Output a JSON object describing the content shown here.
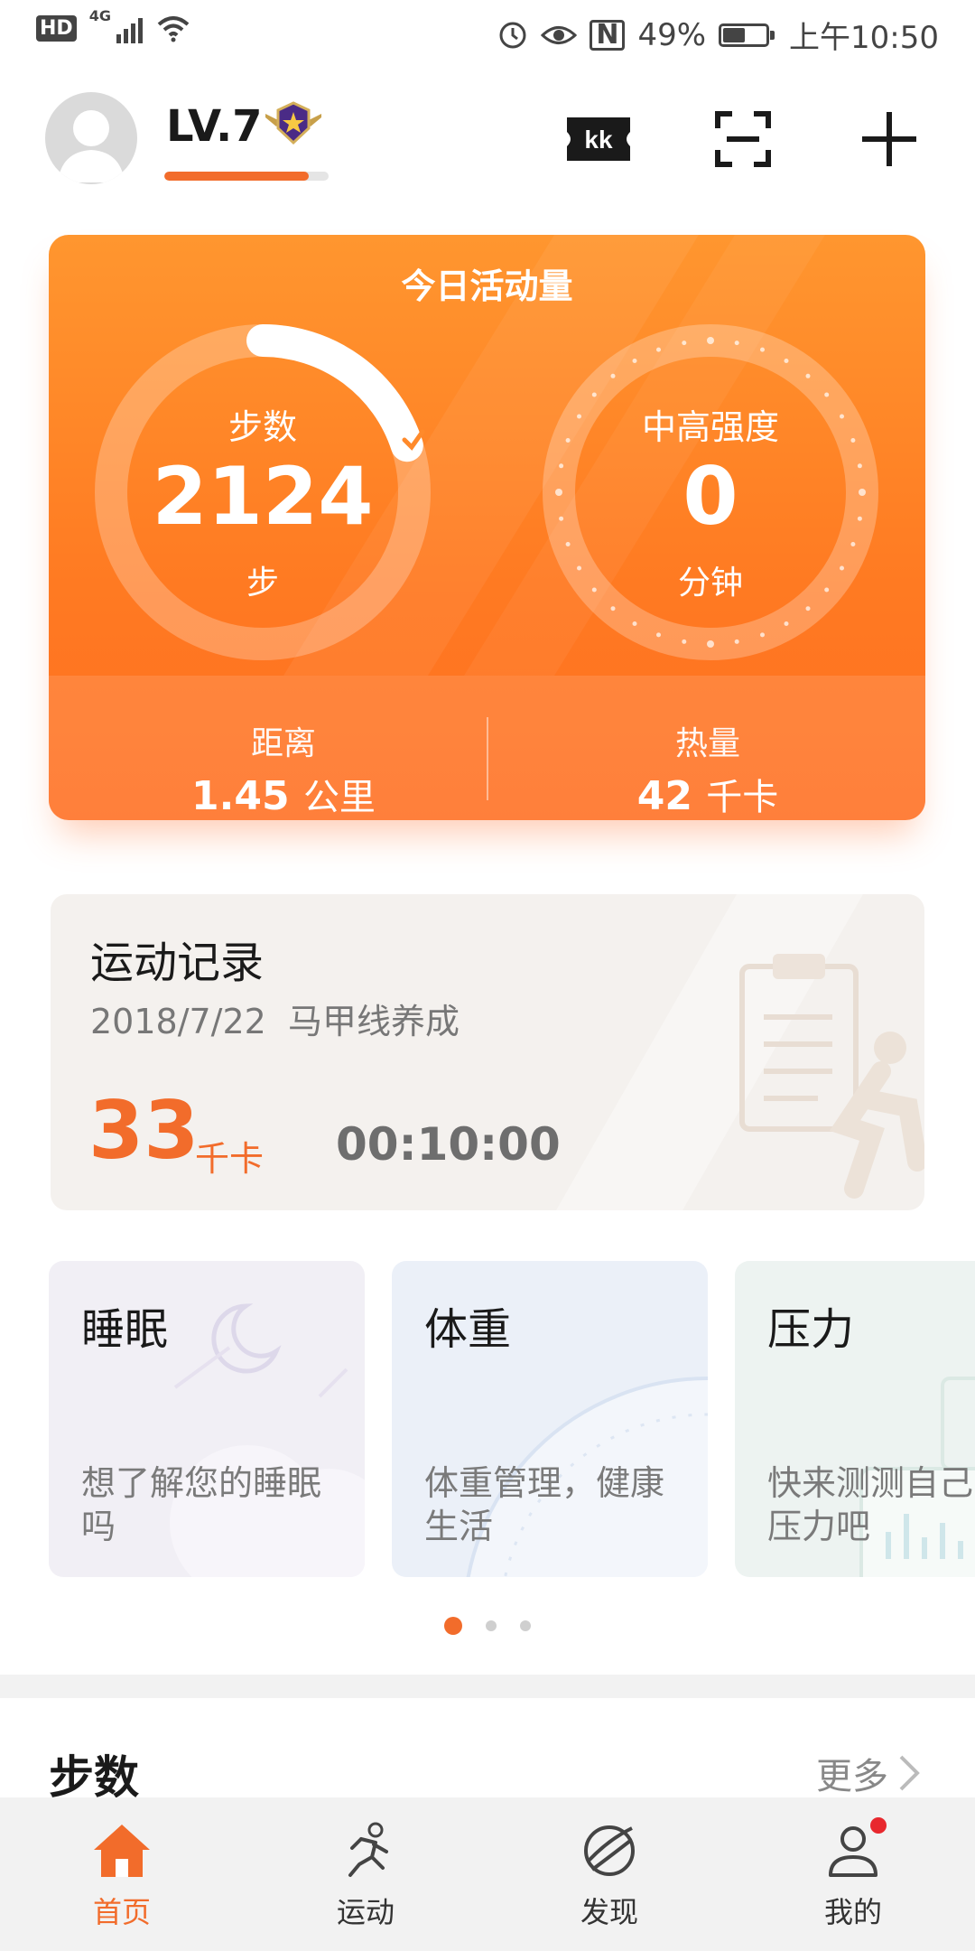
{
  "status_bar": {
    "hd": "HD",
    "signal": "4G",
    "nfc": "N",
    "battery": "49%",
    "time": "上午10:50"
  },
  "header": {
    "level": "LV.7",
    "level_progress": 0.88,
    "ticket_icon_text": "kk"
  },
  "activity": {
    "title": "今日活动量",
    "steps_label": "步数",
    "steps_value": "2124",
    "steps_unit": "步",
    "steps_goal_progress": 0.2,
    "intensity_label": "中高强度",
    "intensity_value": "0",
    "intensity_unit": "分钟",
    "distance_label": "距离",
    "distance_value": "1.45",
    "distance_unit": "公里",
    "calories_label": "热量",
    "calories_value": "42",
    "calories_unit": "千卡"
  },
  "record": {
    "title": "运动记录",
    "date": "2018/7/22",
    "activity": "马甲线养成",
    "calories": "33",
    "calories_unit": "千卡",
    "duration": "00:10:00"
  },
  "cards": [
    {
      "title": "睡眠",
      "subtitle": "想了解您的睡眠吗"
    },
    {
      "title": "体重",
      "subtitle": "体重管理，健康生活"
    },
    {
      "title": "压力",
      "subtitle": "快来测测自己的压力吧"
    }
  ],
  "steps_section": {
    "title": "步数",
    "more": "更多"
  },
  "tabs": [
    {
      "label": "首页",
      "icon": "home-icon",
      "active": true
    },
    {
      "label": "运动",
      "icon": "run-icon",
      "active": false
    },
    {
      "label": "发现",
      "icon": "discover-icon",
      "active": false
    },
    {
      "label": "我的",
      "icon": "profile-icon",
      "active": false
    }
  ],
  "colors": {
    "accent": "#f26c2b",
    "card_gradient_top": "#ff962f",
    "card_gradient_bottom": "#ff6e20"
  }
}
